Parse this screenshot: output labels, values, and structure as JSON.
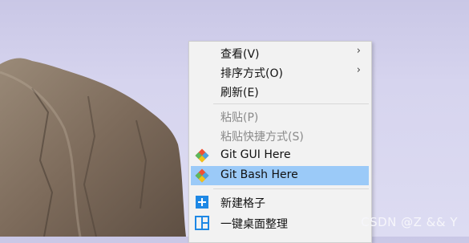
{
  "context_menu": {
    "items": [
      {
        "label": "查看(V)",
        "submenu": true,
        "enabled": true
      },
      {
        "label": "排序方式(O)",
        "submenu": true,
        "enabled": true
      },
      {
        "label": "刷新(E)",
        "submenu": false,
        "enabled": true
      },
      {
        "label": "粘贴(P)",
        "submenu": false,
        "enabled": false
      },
      {
        "label": "粘贴快捷方式(S)",
        "submenu": false,
        "enabled": false
      },
      {
        "label": "Git GUI Here",
        "submenu": false,
        "enabled": true,
        "icon": "git-icon"
      },
      {
        "label": "Git Bash Here",
        "submenu": false,
        "enabled": true,
        "icon": "git-icon",
        "highlighted": true
      },
      {
        "label": "新建格子",
        "submenu": false,
        "enabled": true,
        "icon": "add-box-icon"
      },
      {
        "label": "一键桌面整理",
        "submenu": false,
        "enabled": true,
        "icon": "grid-layout-icon"
      }
    ],
    "highlight_color": "#9bcaf8",
    "submenu_glyph": "›"
  },
  "watermark": "CSDN @Z && Y"
}
